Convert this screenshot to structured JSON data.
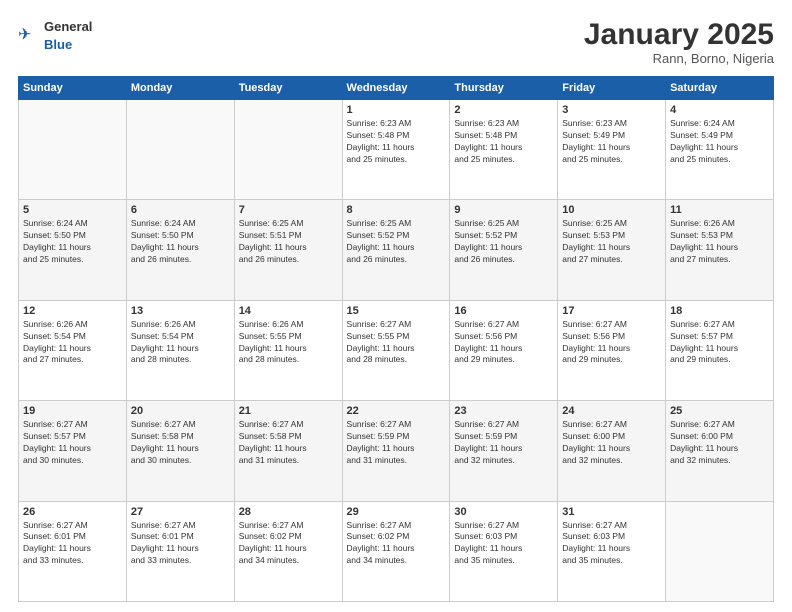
{
  "header": {
    "logo_general": "General",
    "logo_blue": "Blue",
    "title": "January 2025",
    "subtitle": "Rann, Borno, Nigeria"
  },
  "days_of_week": [
    "Sunday",
    "Monday",
    "Tuesday",
    "Wednesday",
    "Thursday",
    "Friday",
    "Saturday"
  ],
  "weeks": [
    [
      {
        "day": "",
        "info": ""
      },
      {
        "day": "",
        "info": ""
      },
      {
        "day": "",
        "info": ""
      },
      {
        "day": "1",
        "info": "Sunrise: 6:23 AM\nSunset: 5:48 PM\nDaylight: 11 hours\nand 25 minutes."
      },
      {
        "day": "2",
        "info": "Sunrise: 6:23 AM\nSunset: 5:48 PM\nDaylight: 11 hours\nand 25 minutes."
      },
      {
        "day": "3",
        "info": "Sunrise: 6:23 AM\nSunset: 5:49 PM\nDaylight: 11 hours\nand 25 minutes."
      },
      {
        "day": "4",
        "info": "Sunrise: 6:24 AM\nSunset: 5:49 PM\nDaylight: 11 hours\nand 25 minutes."
      }
    ],
    [
      {
        "day": "5",
        "info": "Sunrise: 6:24 AM\nSunset: 5:50 PM\nDaylight: 11 hours\nand 25 minutes."
      },
      {
        "day": "6",
        "info": "Sunrise: 6:24 AM\nSunset: 5:50 PM\nDaylight: 11 hours\nand 26 minutes."
      },
      {
        "day": "7",
        "info": "Sunrise: 6:25 AM\nSunset: 5:51 PM\nDaylight: 11 hours\nand 26 minutes."
      },
      {
        "day": "8",
        "info": "Sunrise: 6:25 AM\nSunset: 5:52 PM\nDaylight: 11 hours\nand 26 minutes."
      },
      {
        "day": "9",
        "info": "Sunrise: 6:25 AM\nSunset: 5:52 PM\nDaylight: 11 hours\nand 26 minutes."
      },
      {
        "day": "10",
        "info": "Sunrise: 6:25 AM\nSunset: 5:53 PM\nDaylight: 11 hours\nand 27 minutes."
      },
      {
        "day": "11",
        "info": "Sunrise: 6:26 AM\nSunset: 5:53 PM\nDaylight: 11 hours\nand 27 minutes."
      }
    ],
    [
      {
        "day": "12",
        "info": "Sunrise: 6:26 AM\nSunset: 5:54 PM\nDaylight: 11 hours\nand 27 minutes."
      },
      {
        "day": "13",
        "info": "Sunrise: 6:26 AM\nSunset: 5:54 PM\nDaylight: 11 hours\nand 28 minutes."
      },
      {
        "day": "14",
        "info": "Sunrise: 6:26 AM\nSunset: 5:55 PM\nDaylight: 11 hours\nand 28 minutes."
      },
      {
        "day": "15",
        "info": "Sunrise: 6:27 AM\nSunset: 5:55 PM\nDaylight: 11 hours\nand 28 minutes."
      },
      {
        "day": "16",
        "info": "Sunrise: 6:27 AM\nSunset: 5:56 PM\nDaylight: 11 hours\nand 29 minutes."
      },
      {
        "day": "17",
        "info": "Sunrise: 6:27 AM\nSunset: 5:56 PM\nDaylight: 11 hours\nand 29 minutes."
      },
      {
        "day": "18",
        "info": "Sunrise: 6:27 AM\nSunset: 5:57 PM\nDaylight: 11 hours\nand 29 minutes."
      }
    ],
    [
      {
        "day": "19",
        "info": "Sunrise: 6:27 AM\nSunset: 5:57 PM\nDaylight: 11 hours\nand 30 minutes."
      },
      {
        "day": "20",
        "info": "Sunrise: 6:27 AM\nSunset: 5:58 PM\nDaylight: 11 hours\nand 30 minutes."
      },
      {
        "day": "21",
        "info": "Sunrise: 6:27 AM\nSunset: 5:58 PM\nDaylight: 11 hours\nand 31 minutes."
      },
      {
        "day": "22",
        "info": "Sunrise: 6:27 AM\nSunset: 5:59 PM\nDaylight: 11 hours\nand 31 minutes."
      },
      {
        "day": "23",
        "info": "Sunrise: 6:27 AM\nSunset: 5:59 PM\nDaylight: 11 hours\nand 32 minutes."
      },
      {
        "day": "24",
        "info": "Sunrise: 6:27 AM\nSunset: 6:00 PM\nDaylight: 11 hours\nand 32 minutes."
      },
      {
        "day": "25",
        "info": "Sunrise: 6:27 AM\nSunset: 6:00 PM\nDaylight: 11 hours\nand 32 minutes."
      }
    ],
    [
      {
        "day": "26",
        "info": "Sunrise: 6:27 AM\nSunset: 6:01 PM\nDaylight: 11 hours\nand 33 minutes."
      },
      {
        "day": "27",
        "info": "Sunrise: 6:27 AM\nSunset: 6:01 PM\nDaylight: 11 hours\nand 33 minutes."
      },
      {
        "day": "28",
        "info": "Sunrise: 6:27 AM\nSunset: 6:02 PM\nDaylight: 11 hours\nand 34 minutes."
      },
      {
        "day": "29",
        "info": "Sunrise: 6:27 AM\nSunset: 6:02 PM\nDaylight: 11 hours\nand 34 minutes."
      },
      {
        "day": "30",
        "info": "Sunrise: 6:27 AM\nSunset: 6:03 PM\nDaylight: 11 hours\nand 35 minutes."
      },
      {
        "day": "31",
        "info": "Sunrise: 6:27 AM\nSunset: 6:03 PM\nDaylight: 11 hours\nand 35 minutes."
      },
      {
        "day": "",
        "info": ""
      }
    ]
  ]
}
